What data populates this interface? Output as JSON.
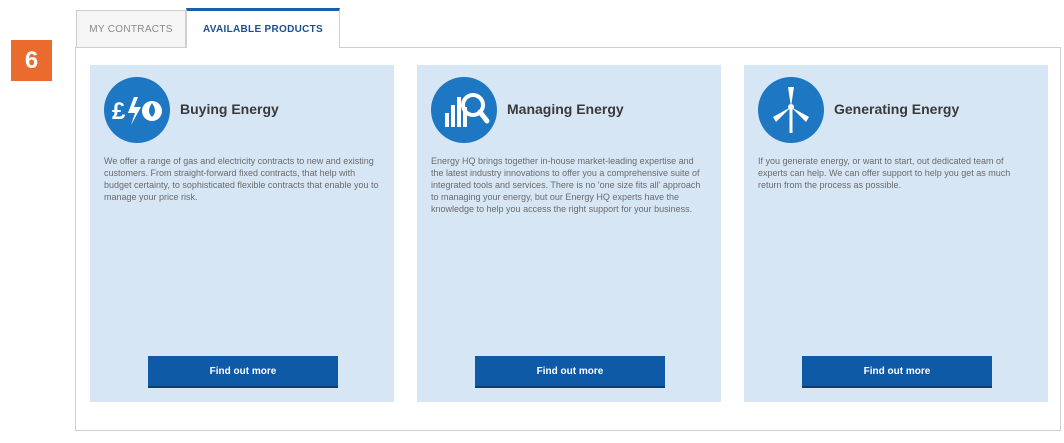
{
  "step_number": "6",
  "tabs": [
    {
      "label": "MY CONTRACTS",
      "active": false
    },
    {
      "label": "AVAILABLE PRODUCTS",
      "active": true
    }
  ],
  "cards": [
    {
      "icon": "currency-energy-icon",
      "icon_text": "£/∆",
      "title": "Buying Energy",
      "body": "We offer a range of gas and electricity contracts to new and existing customers. From straight-forward fixed contracts, that help with budget certainty, to sophisticated flexible contracts that enable you to manage your price risk.",
      "button": "Find out more"
    },
    {
      "icon": "chart-magnifier-icon",
      "title": "Managing Energy",
      "body": "Energy HQ brings together in-house market-leading expertise and the latest industry innovations to offer you a comprehensive suite of integrated tools and services. There is no 'one size fits all' approach to managing your energy, but our Energy HQ experts have the knowledge to help you access the right support for your business.",
      "button": "Find out more"
    },
    {
      "icon": "wind-turbine-icon",
      "title": "Generating Energy",
      "body": "If you generate energy, or want to start, out dedicated team of experts can help. We can offer support to help you get as much return from the process as possible.",
      "button": "Find out more"
    }
  ],
  "colors": {
    "badge": "#ea6b2d",
    "card_bg": "#d6e6f4",
    "icon_bg": "#1d77c2",
    "button_bg": "#0e5aa6"
  }
}
